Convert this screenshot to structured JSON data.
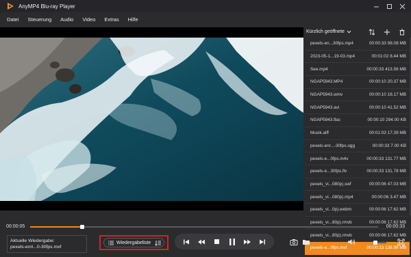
{
  "window": {
    "title": "AnyMP4 Blu-ray Player",
    "controls": [
      "minimize",
      "maximize",
      "close"
    ]
  },
  "menu": {
    "items": [
      "Datei",
      "Steuerung",
      "Audio",
      "Video",
      "Extras",
      "Hilfe"
    ]
  },
  "playlist": {
    "dropdown_label": "Kürzlich geöffnete",
    "tools": [
      "sort-icon",
      "add-icon",
      "trash-icon"
    ],
    "items": [
      {
        "name": "pexels-en...30fps.mp4",
        "duration": "00:00:33",
        "size": "98.08 MB"
      },
      {
        "name": "2023-05-1...19-03.mp4",
        "duration": "00:01:02",
        "size": "8.44 MB"
      },
      {
        "name": "See.mp4",
        "duration": "00:00:33",
        "size": "413.56 MB"
      },
      {
        "name": "NGAP5943.MP4",
        "duration": "00:00:10",
        "size": "20.37 MB"
      },
      {
        "name": "NGAP5943.wmv",
        "duration": "00:00:10",
        "size": "18.17 MB"
      },
      {
        "name": "NGAP5943.avi",
        "duration": "00:00:10",
        "size": "41.52 MB"
      },
      {
        "name": "NGAP5943.flac",
        "duration": "00:00:10",
        "size": "294.00 KB"
      },
      {
        "name": "Musik.aiff",
        "duration": "00:01:03",
        "size": "17.39 MB"
      },
      {
        "name": "pexels-enr...-30fps.ogg",
        "duration": "00:00:33",
        "size": "7.00 KB"
      },
      {
        "name": "pexels-e...0fps.m4v",
        "duration": "00:00:33",
        "size": "131.77 MB"
      },
      {
        "name": "pexels-e...30fps.flv",
        "duration": "00:00:33",
        "size": "131.78 MB"
      },
      {
        "name": "pexels_vi...080p).swf",
        "duration": "00:00:06",
        "size": "47.03 MB"
      },
      {
        "name": "pexels_vi...080p).mp4",
        "duration": "00:00:06",
        "size": "3.47 MB"
      },
      {
        "name": "pexels_vi...0p).webm",
        "duration": "00:00:06",
        "size": "17.62 MB"
      },
      {
        "name": "pexels_vi...80p).rmvb",
        "duration": "00:00:06",
        "size": "17.62 MB"
      },
      {
        "name": "pexels_vi...80p).rmvb",
        "duration": "00:00:06",
        "size": "17.62 MB"
      },
      {
        "name": "pexels-e...0fps.mxf",
        "duration": "00:00:33",
        "size": "138.96 MB",
        "active": true
      }
    ]
  },
  "playback": {
    "current_time": "00:00:05",
    "total_time": "00:00:33",
    "progress_percent": 15,
    "volume_percent": 60
  },
  "now_playing": {
    "label": "Aktuelle Wiedergabe:",
    "file": "pexels-enri...0-30fps.mxf"
  },
  "playlist_toggle": {
    "label": "Wiedergabeliste"
  },
  "colors": {
    "accent": "#f08a1e",
    "active_row": "#f28a1c",
    "highlight_box": "#d9201f",
    "background": "#2b2b2d"
  }
}
